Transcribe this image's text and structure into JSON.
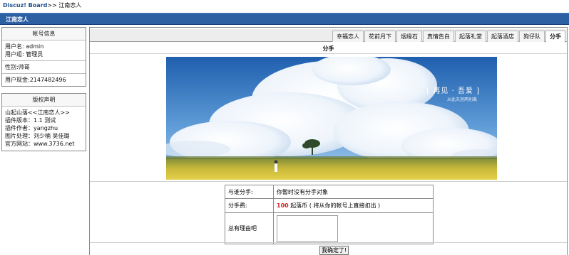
{
  "breadcrumb": {
    "home": "Discuz! Board",
    "separator": ">>",
    "current": "江南恋人"
  },
  "titlebar": {
    "title": "江南恋人"
  },
  "account_panel": {
    "title": "帐号信息",
    "username": "用户名: admin",
    "group": "用户组: 管理员",
    "gender": "性别:帅哥",
    "cash": "用户现金:2147482496"
  },
  "copyright_panel": {
    "title": "版权声明",
    "lines": [
      "山起山落<<江南恋人>>",
      "插件版本：1.1 测试",
      "插件作者：yangzhu",
      "图片处理：刘少楠 吴佳璐",
      "官方网站：www.3736.net"
    ]
  },
  "tabs": [
    "幸福恋人",
    "花前月下",
    "烟缘石",
    "真情告白",
    "起落礼堂",
    "起落酒店",
    "狗仔队",
    "分手"
  ],
  "active_tab": "分手",
  "section_title": "分手",
  "banner": {
    "title": "[ 再见 · 吾爱 ]",
    "subtitle": "从此天涯两别离"
  },
  "form": {
    "partner_label": "与谁分手:",
    "partner_value": "你暂时没有分手对象",
    "fee_label": "分手费:",
    "fee_amount": "100",
    "fee_text": " 起落币 ( 将从你的帐号上直接扣出 )",
    "reason_label": "总有理由吧",
    "reason_value": ""
  },
  "confirm_label": "我确定了!"
}
